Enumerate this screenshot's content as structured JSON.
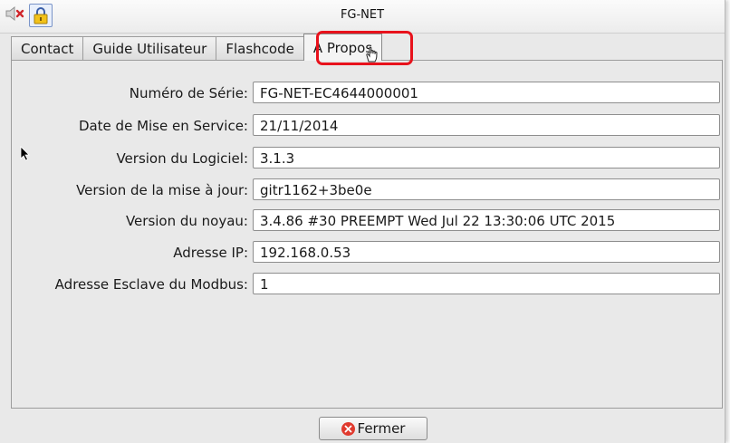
{
  "window": {
    "title": "FG-NET",
    "icons": [
      "speaker-muted-icon",
      "lock-icon"
    ]
  },
  "tabs": [
    {
      "label": "Contact",
      "active": false
    },
    {
      "label": "Guide Utilisateur",
      "active": false
    },
    {
      "label": "Flashcode",
      "active": false
    },
    {
      "label": "A Propos",
      "active": true
    }
  ],
  "fields": [
    {
      "label": "Numéro de Série:",
      "value": "FG-NET-EC4644000001"
    },
    {
      "label": "Date de Mise en Service:",
      "value": "21/11/2014"
    },
    {
      "label": "Version du Logiciel:",
      "value": "3.1.3"
    },
    {
      "label": "Version de la mise à jour:",
      "value": "gitr1162+3be0e"
    },
    {
      "label": "Version du noyau:",
      "value": "3.4.86 #30 PREEMPT Wed Jul 22 13:30:06 UTC 2015"
    },
    {
      "label": "Adresse IP:",
      "value": "192.168.0.53"
    },
    {
      "label": "Adresse Esclave du Modbus:",
      "value": "1"
    }
  ],
  "footer": {
    "close_label": "Fermer"
  },
  "colors": {
    "highlight": "#e8121c",
    "close_icon": "#e03a2e"
  }
}
